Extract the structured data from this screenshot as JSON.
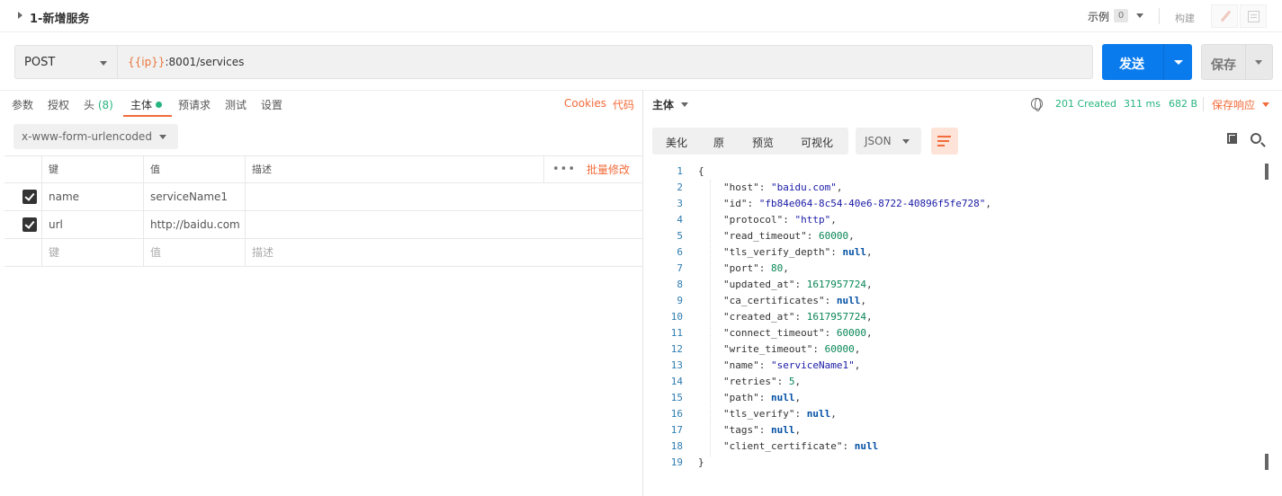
{
  "request": {
    "title": "1-新增服务",
    "example_label": "示例",
    "example_count": "0",
    "build_label": "构建",
    "method": "POST",
    "url_var": "{{ip}}",
    "url_rest": ":8001/services",
    "send_label": "发送",
    "save_label": "保存"
  },
  "left_tabs": [
    {
      "label": "参数"
    },
    {
      "label": "授权"
    },
    {
      "label": "头",
      "count": "(8)"
    },
    {
      "label": "主体",
      "active": true
    },
    {
      "label": "预请求"
    },
    {
      "label": "测试"
    },
    {
      "label": "设置"
    }
  ],
  "links": {
    "cookies": "Cookies",
    "code": "代码"
  },
  "body_type": "x-www-form-urlencoded",
  "table": {
    "headers": {
      "key": "键",
      "value": "值",
      "description": "描述",
      "more": "•••",
      "bulk_edit": "批量修改"
    },
    "rows": [
      {
        "checked": true,
        "key": "name",
        "value": "serviceName1",
        "description": ""
      },
      {
        "checked": true,
        "key": "url",
        "value": "http://baidu.com",
        "description": ""
      }
    ],
    "placeholder": {
      "key": "键",
      "value": "值",
      "description": "描述"
    }
  },
  "response": {
    "title": "主体",
    "status": "201 Created",
    "time": "311 ms",
    "size": "682 B",
    "save_response": "保存响应",
    "view_tabs": [
      "美化",
      "原",
      "预览",
      "可视化"
    ],
    "format": "JSON",
    "lines": [
      "1",
      "2",
      "3",
      "4",
      "5",
      "6",
      "7",
      "8",
      "9",
      "10",
      "11",
      "12",
      "13",
      "14",
      "15",
      "16",
      "17",
      "18",
      "19"
    ],
    "json_lines": [
      {
        "t": "{"
      },
      {
        "k": "\"host\"",
        "v": "\"baidu.com\"",
        "vt": "s",
        "c": ","
      },
      {
        "k": "\"id\"",
        "v": "\"fb84e064-8c54-40e6-8722-40896f5fe728\"",
        "vt": "s",
        "c": ","
      },
      {
        "k": "\"protocol\"",
        "v": "\"http\"",
        "vt": "s",
        "c": ","
      },
      {
        "k": "\"read_timeout\"",
        "v": "60000",
        "vt": "n",
        "c": ","
      },
      {
        "k": "\"tls_verify_depth\"",
        "v": "null",
        "vt": "nl",
        "c": ","
      },
      {
        "k": "\"port\"",
        "v": "80",
        "vt": "n",
        "c": ","
      },
      {
        "k": "\"updated_at\"",
        "v": "1617957724",
        "vt": "n",
        "c": ","
      },
      {
        "k": "\"ca_certificates\"",
        "v": "null",
        "vt": "nl",
        "c": ","
      },
      {
        "k": "\"created_at\"",
        "v": "1617957724",
        "vt": "n",
        "c": ","
      },
      {
        "k": "\"connect_timeout\"",
        "v": "60000",
        "vt": "n",
        "c": ","
      },
      {
        "k": "\"write_timeout\"",
        "v": "60000",
        "vt": "n",
        "c": ","
      },
      {
        "k": "\"name\"",
        "v": "\"serviceName1\"",
        "vt": "s",
        "c": ","
      },
      {
        "k": "\"retries\"",
        "v": "5",
        "vt": "n",
        "c": ","
      },
      {
        "k": "\"path\"",
        "v": "null",
        "vt": "nl",
        "c": ","
      },
      {
        "k": "\"tls_verify\"",
        "v": "null",
        "vt": "nl",
        "c": ","
      },
      {
        "k": "\"tags\"",
        "v": "null",
        "vt": "nl",
        "c": ","
      },
      {
        "k": "\"client_certificate\"",
        "v": "null",
        "vt": "nl",
        "c": ""
      },
      {
        "t": "}"
      }
    ]
  },
  "colors": {
    "accent": "#f26b3a",
    "primary": "#097bed",
    "success": "#26b47f"
  }
}
